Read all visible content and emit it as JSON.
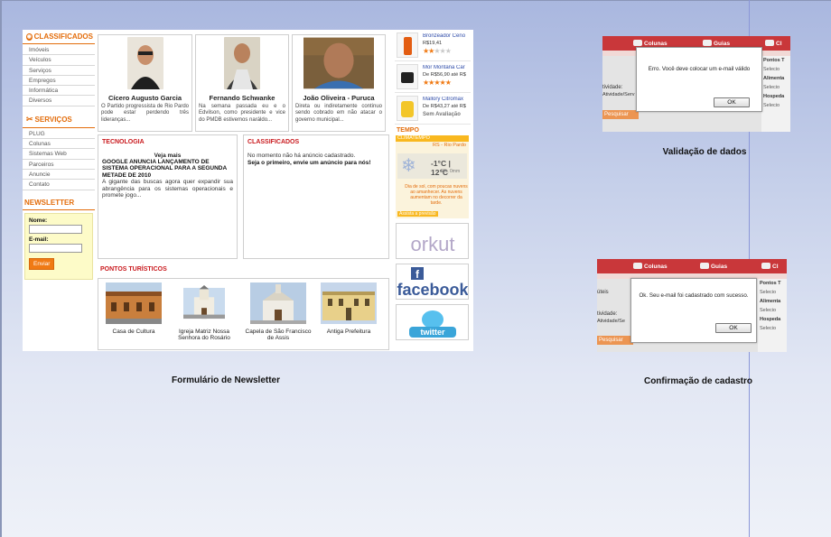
{
  "newsletter_shot": {
    "sidebar": {
      "classificados_title": "CLASSIFICADOS",
      "classificados_items": [
        "Imóveis",
        "Veículos",
        "Serviços",
        "Empregos",
        "Informática",
        "Diversos"
      ],
      "servicos_title": "SERVIÇOS",
      "servicos_items": [
        "PLUG",
        "Colunas",
        "Sistemas Web",
        "Parceiros",
        "Anuncie",
        "Contato"
      ],
      "newsletter_title": "NEWSLETTER",
      "nome_label": "Nome:",
      "email_label": "E-mail:",
      "enviar_label": "Enviar"
    },
    "people": [
      {
        "name": "Cícero Augusto Garcia",
        "text": "O Partido progressista de Rio Pardo pode estar perdendo três lideranças..."
      },
      {
        "name": "Fernando Schwanke",
        "text": "Na semana passada eu e o Edvilson, como presidente e vice do PMDB estivemos naráldo..."
      },
      {
        "name": "João Oliveira - Puruca",
        "text": "Direta ou indiretamente continuo sendo cobrado em não atacar o governo municipal..."
      }
    ],
    "tecnologia": {
      "title": "TECNOLOGIA",
      "subtitle": "Veja mais",
      "headline": "GOOGLE ANUNCIA LANÇAMENTO DE SISTEMA OPERACIONAL PARA A SEGUNDA METADE DE 2010",
      "body": "A gigante das buscas agora quer expandir sua abrangência para os sistemas operacionais e promete jogo..."
    },
    "classificados_panel": {
      "title": "CLASSIFICADOS",
      "line1": "No momento não há anúncio cadastrado.",
      "line2": "Seja o primeiro, envie um anúncio para nós!"
    },
    "pontos": {
      "title": "PONTOS TURÍSTICOS",
      "items": [
        "Casa de Cultura",
        "Igreja Matriz Nossa Senhora do Rosário",
        "Capela de São Francisco de Assis",
        "Antiga Prefeitura"
      ]
    },
    "products": [
      {
        "title": "Bronzeador Ceno",
        "price": "R$19,41",
        "rating": 2,
        "label": ""
      },
      {
        "title": "Mor Montana Car",
        "price": "De R$56,90 até R$",
        "rating": 5,
        "label": ""
      },
      {
        "title": "Mallory Citromax",
        "price": "De R$43,27 até R$",
        "rating": 0,
        "label": "Sem Avaliação"
      }
    ],
    "tempo": {
      "title": "TEMPO",
      "bar": "CLIMATEMPO",
      "city": "RS - Rio Pardo",
      "temp": "-1°C | 12°C",
      "extra": "0%,   0mm",
      "advice": "Dia de sol, com poucas nuvens ao amanhecer. As nuvens aumentam no decorrer da tarde.",
      "assist": "Assista a previsão"
    },
    "social": [
      "orkut",
      "facebook",
      "twitter"
    ]
  },
  "captions": {
    "newsletter": "Formulário de Newsletter",
    "validacao": "Validação de dados",
    "confirmacao": "Confirmação de cadastro"
  },
  "validation_shot": {
    "tabs": [
      "Colunas",
      "Guias",
      "Cl"
    ],
    "side_left": [
      "tividade:",
      "Atividade/Serv"
    ],
    "pesquisar": "Pesquisar",
    "right": [
      "Pontos T",
      "Selecio",
      "Alimenta",
      "Selecio",
      "Hospeda",
      "Selecio"
    ],
    "message": "Erro. Você deve colocar um e-mail válido",
    "ok_label": "OK"
  },
  "confirm_shot": {
    "tabs": [
      "Colunas",
      "Guias",
      "Cl"
    ],
    "side_left": [
      "úteis",
      "tividade:",
      "Atividade/Se"
    ],
    "pesquisar": "Pesquisar",
    "right": [
      "Pontos T",
      "Selecio",
      "Alimenta",
      "Selecio",
      "Hospeda",
      "Selecio"
    ],
    "message": "Ok. Seu e-mail foi cadastrado com sucesso.",
    "ok_label": "OK"
  },
  "colors": {
    "accent_orange": "#e36c0a",
    "section_red": "#c9191d",
    "topbar_red": "#c9373a",
    "background_blue": "#a9b7df"
  }
}
